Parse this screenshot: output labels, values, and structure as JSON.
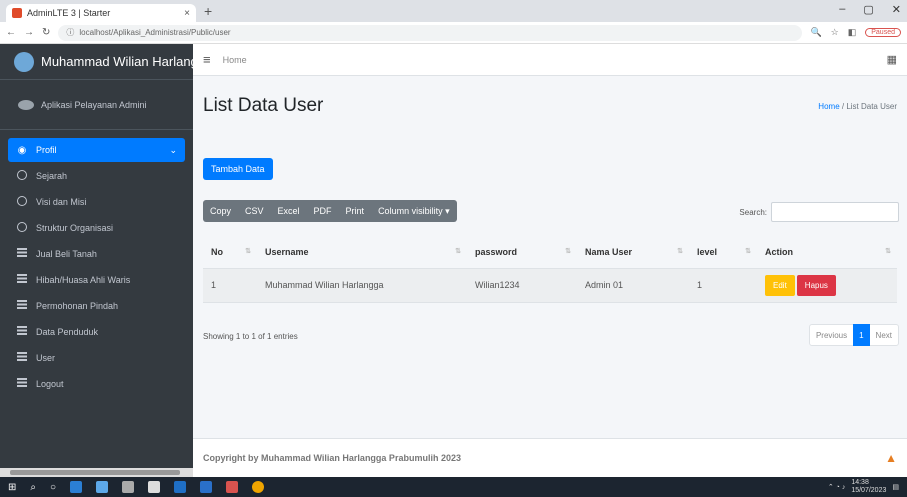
{
  "browser": {
    "tab_title": "AdminLTE 3 | Starter",
    "tab_close": "×",
    "new_tab": "+",
    "url": "localhost/Aplikasi_Administrasi/Public/user",
    "paused": "Paused"
  },
  "sidebar": {
    "brand": "Muhammad Wilian Harlangga",
    "user_panel": "Aplikasi Pelayanan Admini",
    "items": [
      {
        "label": "Profil",
        "icon": "dashboard-icon",
        "active": true
      },
      {
        "label": "Sejarah",
        "icon": "circle-icon"
      },
      {
        "label": "Visi dan Misi",
        "icon": "circle-icon"
      },
      {
        "label": "Struktur Organisasi",
        "icon": "circle-icon"
      },
      {
        "label": "Jual Beli Tanah",
        "icon": "table-icon"
      },
      {
        "label": "Hibah/Huasa Ahli Waris",
        "icon": "table-icon"
      },
      {
        "label": "Permohonan Pindah",
        "icon": "table-icon"
      },
      {
        "label": "Data Penduduk",
        "icon": "table-icon"
      },
      {
        "label": "User",
        "icon": "table-icon"
      },
      {
        "label": "Logout",
        "icon": "table-icon"
      }
    ]
  },
  "topnav": {
    "home": "Home"
  },
  "header": {
    "title": "List Data User",
    "crumb_home": "Home",
    "crumb_sep": " / ",
    "crumb_current": "List Data User"
  },
  "card": {
    "add_button": "Tambah Data",
    "dt_buttons": [
      "Copy",
      "CSV",
      "Excel",
      "PDF",
      "Print",
      "Column visibility ▾"
    ],
    "search_label": "Search:",
    "columns": [
      "No",
      "Username",
      "password",
      "Nama User",
      "level",
      "Action"
    ],
    "rows": [
      {
        "no": "1",
        "username": "Muhammad Wilian Harlangga",
        "password": "Wilian1234",
        "nama": "Admin 01",
        "level": "1"
      }
    ],
    "edit_label": "Edit",
    "delete_label": "Hapus",
    "info": "Showing 1 to 1 of 1 entries",
    "prev": "Previous",
    "page": "1",
    "next": "Next"
  },
  "footer": {
    "text": "Copyright by Muhammad Wilian Harlangga Prabumulih 2023"
  },
  "taskbar": {
    "time": "14:38",
    "date": "15/07/2023"
  }
}
